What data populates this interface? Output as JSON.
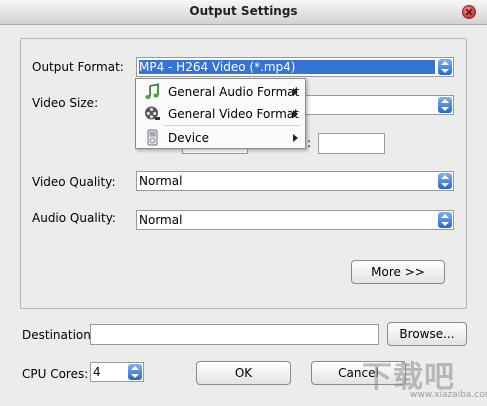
{
  "window": {
    "title": "Output Settings"
  },
  "form": {
    "output_format_label": "Output Format:",
    "output_format_value": "MP4 - H264 Video (*.mp4)",
    "video_size_label": "Video Size:",
    "video_size_value": "",
    "height_label_partial": ":",
    "video_quality_label": "Video Quality:",
    "video_quality_value": "Normal",
    "audio_quality_label": "Audio Quality:",
    "audio_quality_value": "Normal",
    "more_button": "More >>",
    "destination_label": "Destination:",
    "destination_value": "",
    "browse_button": "Browse...",
    "cpu_cores_label": "CPU Cores:",
    "cpu_cores_value": "4",
    "ok_button": "OK",
    "cancel_button": "Cancel"
  },
  "format_menu": {
    "items": [
      {
        "label": "General Audio Format",
        "icon": "music-note-icon"
      },
      {
        "label": "General Video Format",
        "icon": "film-reel-icon"
      },
      {
        "label": "Device",
        "icon": "device-icon"
      }
    ]
  },
  "watermark": {
    "line1": "下载吧",
    "line2": "www.xiazaiba.com"
  },
  "colors": {
    "selection": "#3574d4",
    "combo_arrow": "#2a66c9",
    "close_button": "#d9534f"
  }
}
